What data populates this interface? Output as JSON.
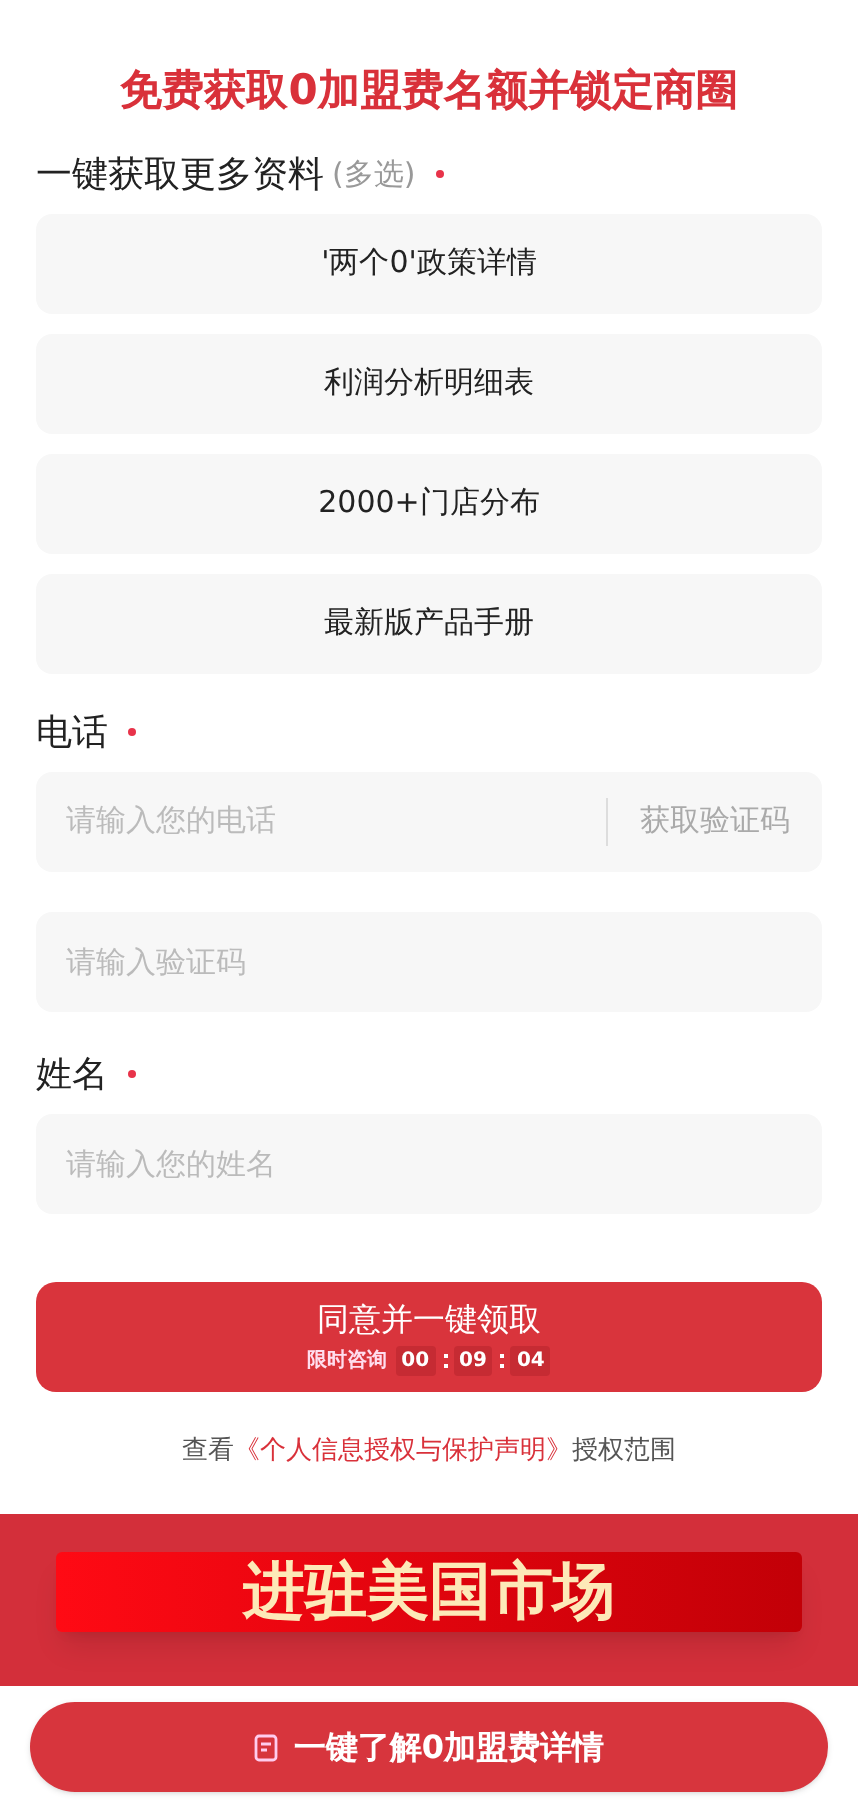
{
  "title": "免费获取0加盟费名额并锁定商圈",
  "materials": {
    "label": "一键获取更多资料",
    "hint": "(多选)",
    "required": true,
    "options": [
      {
        "label": "'两个0'政策详情",
        "selected": false
      },
      {
        "label": "利润分析明细表",
        "selected": false
      },
      {
        "label": "2000+门店分布",
        "selected": false
      },
      {
        "label": "最新版产品手册",
        "selected": false
      }
    ]
  },
  "phone": {
    "label": "电话",
    "required": true,
    "placeholder": "请输入您的电话",
    "code_button": "获取验证码",
    "code_placeholder": "请输入验证码"
  },
  "name": {
    "label": "姓名",
    "required": true,
    "placeholder": "请输入您的姓名"
  },
  "submit": {
    "label": "同意并一键领取",
    "countdown_label": "限时咨询",
    "countdown": [
      "00",
      "09",
      "04"
    ]
  },
  "consent": {
    "prefix": "查看",
    "link": "《个人信息授权与保护声明》",
    "suffix": "授权范围"
  },
  "banner": {
    "text": "进驻美国市场"
  },
  "floating_button": {
    "label": "一键了解0加盟费详情"
  }
}
